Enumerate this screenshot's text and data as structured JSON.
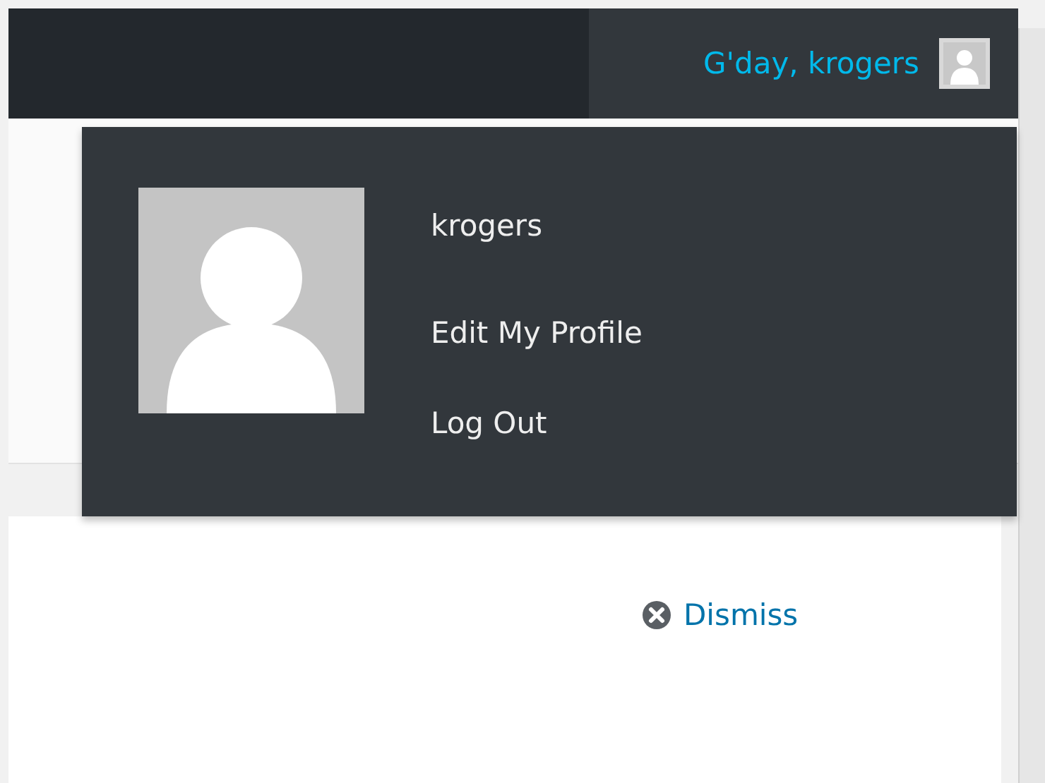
{
  "admin_bar": {
    "account": {
      "greeting": "G'day, krogers",
      "expanded": true
    }
  },
  "account_menu": {
    "username": "krogers",
    "links": [
      "Edit My Profile",
      "Log Out"
    ]
  },
  "notice": {
    "dismiss": "Dismiss"
  }
}
